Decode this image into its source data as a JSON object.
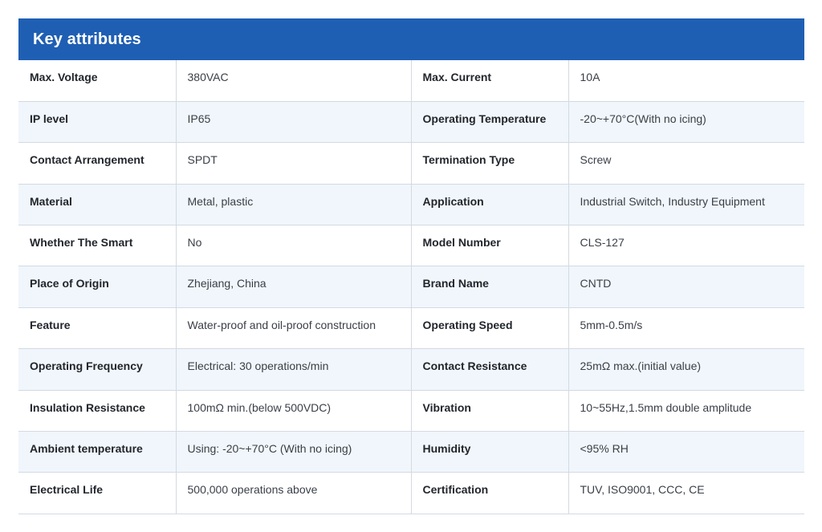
{
  "header": {
    "title": "Key attributes"
  },
  "rows": [
    {
      "k1": "Max. Voltage",
      "v1": "380VAC",
      "k2": "Max. Current",
      "v2": "10A"
    },
    {
      "k1": "IP level",
      "v1": "IP65",
      "k2": "Operating Temperature",
      "v2": "-20~+70°C(With no icing)"
    },
    {
      "k1": "Contact Arrangement",
      "v1": "SPDT",
      "k2": "Termination Type",
      "v2": "Screw"
    },
    {
      "k1": "Material",
      "v1": "Metal, plastic",
      "k2": "Application",
      "v2": "Industrial Switch, Industry Equipment"
    },
    {
      "k1": "Whether The Smart",
      "v1": "No",
      "k2": "Model Number",
      "v2": "CLS-127"
    },
    {
      "k1": "Place of Origin",
      "v1": "Zhejiang, China",
      "k2": "Brand Name",
      "v2": "CNTD"
    },
    {
      "k1": "Feature",
      "v1": "Water-proof and oil-proof construction",
      "k2": "Operating Speed",
      "v2": "5mm-0.5m/s"
    },
    {
      "k1": "Operating Frequency",
      "v1": "Electrical: 30 operations/min",
      "k2": "Contact Resistance",
      "v2": "25mΩ max.(initial value)"
    },
    {
      "k1": "Insulation Resistance",
      "v1": "100mΩ min.(below 500VDC)",
      "k2": "Vibration",
      "v2": "10~55Hz,1.5mm double amplitude"
    },
    {
      "k1": "Ambient temperature",
      "v1": "Using: -20~+70°C (With no icing)",
      "k2": "Humidity",
      "v2": "<95% RH"
    },
    {
      "k1": "Electrical Life",
      "v1": "500,000 operations above",
      "k2": "Certification",
      "v2": "TUV, ISO9001, CCC, CE"
    }
  ]
}
